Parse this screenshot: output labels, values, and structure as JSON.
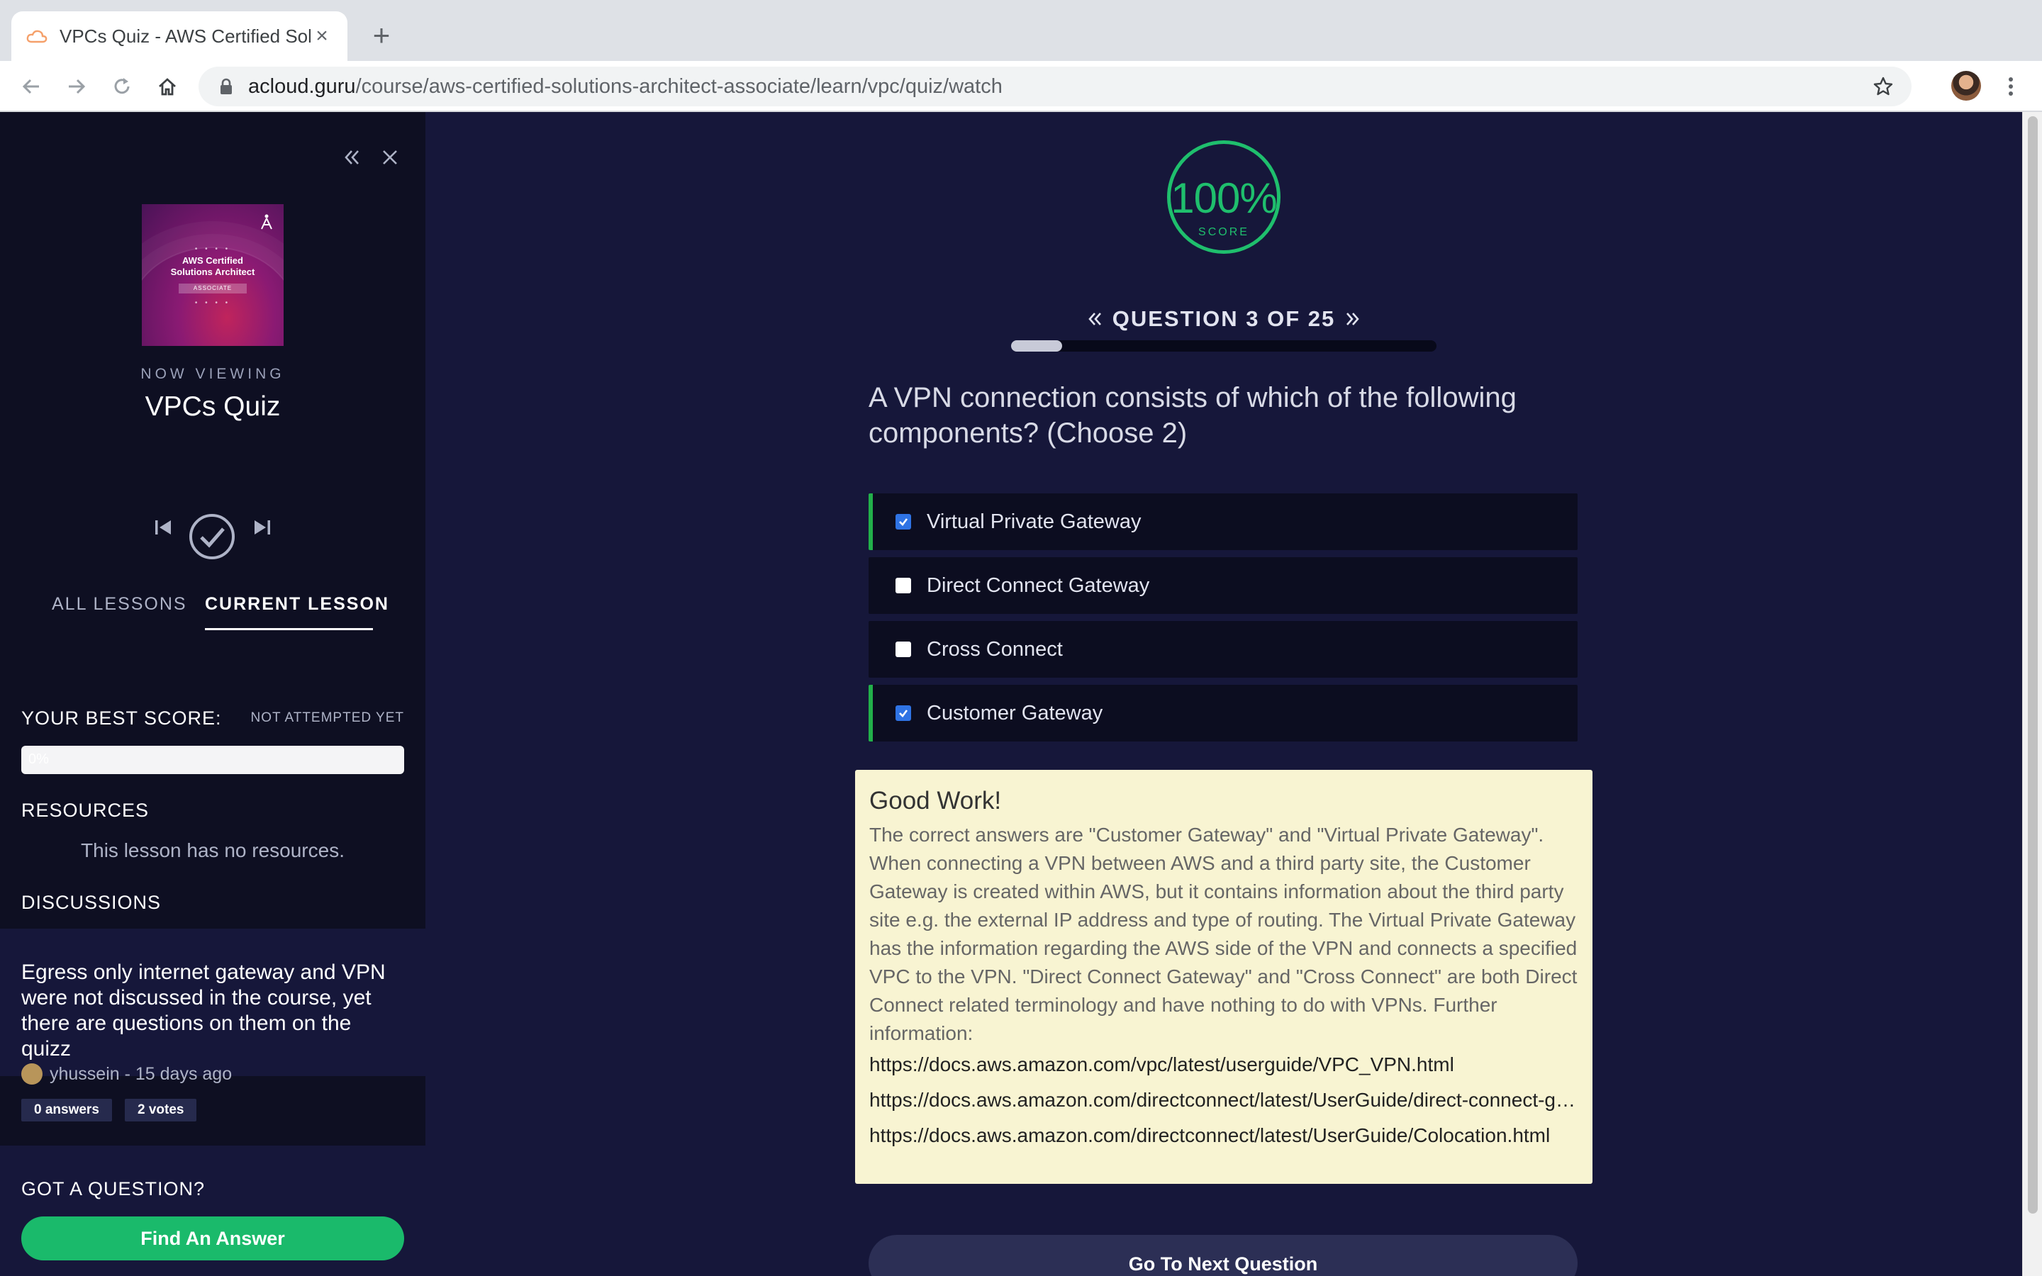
{
  "browser": {
    "tab_title": "VPCs Quiz - AWS Certified Solutions Architect",
    "url_domain": "acloud.guru",
    "url_path": "/course/aws-certified-solutions-architect-associate/learn/vpc/quiz/watch"
  },
  "sidebar": {
    "thumb_title_line1": "AWS Certified",
    "thumb_title_line2": "Solutions Architect",
    "thumb_badge": "ASSOCIATE",
    "now_viewing": "NOW VIEWING",
    "lesson_title": "VPCs Quiz",
    "tab_all_lessons": "ALL LESSONS",
    "tab_current_lesson": "CURRENT LESSON",
    "best_score_label": "YOUR BEST SCORE:",
    "best_score_status": "NOT ATTEMPTED YET",
    "best_score_value": "0%",
    "resources_label": "RESOURCES",
    "no_resources": "This lesson has no resources.",
    "discussions_label": "DISCUSSIONS",
    "discussion": {
      "title": "Egress only internet gateway and VPN were not discussed in the course, yet there are questions on them on the quizz",
      "author": "yhussein",
      "time": "15 days ago",
      "answers": "0 answers",
      "votes": "2 votes"
    },
    "got_question": "GOT A QUESTION?",
    "find_answer": "Find An Answer"
  },
  "quiz": {
    "score_pct": "100%",
    "score_label": "SCORE",
    "question_counter": "QUESTION 3 OF 25",
    "progress_fraction": 0.12,
    "question": "A VPN connection consists of which of the following components? (Choose 2)",
    "options": [
      {
        "label": "Virtual Private Gateway",
        "checked": true
      },
      {
        "label": "Direct Connect Gateway",
        "checked": false
      },
      {
        "label": "Cross Connect",
        "checked": false
      },
      {
        "label": "Customer Gateway",
        "checked": true
      }
    ],
    "feedback_title": "Good Work!",
    "feedback_body": "The correct answers are \"Customer Gateway\" and \"Virtual Private Gateway\". When connecting a VPN between AWS and a third party site, the Customer Gateway is created within AWS, but it contains information about the third party site e.g. the external IP address and type of routing. The Virtual Private Gateway has the information regarding the AWS side of the VPN and connects a specified VPC to the VPN. \"Direct Connect Gateway\" and \"Cross Connect\" are both Direct Connect related terminology and have nothing to do with VPNs. Further information:",
    "links": [
      "https://docs.aws.amazon.com/vpc/latest/userguide/VPC_VPN.html",
      "https://docs.aws.amazon.com/directconnect/latest/UserGuide/direct-connect-gateways.html",
      "https://docs.aws.amazon.com/directconnect/latest/UserGuide/Colocation.html"
    ],
    "next_button": "Go To Next Question"
  },
  "colors": {
    "accent_green": "#1fbf6d",
    "correct_bar": "#22b04a",
    "checkbox_blue": "#2f73e4",
    "feedback_bg": "#f8f4d2"
  }
}
